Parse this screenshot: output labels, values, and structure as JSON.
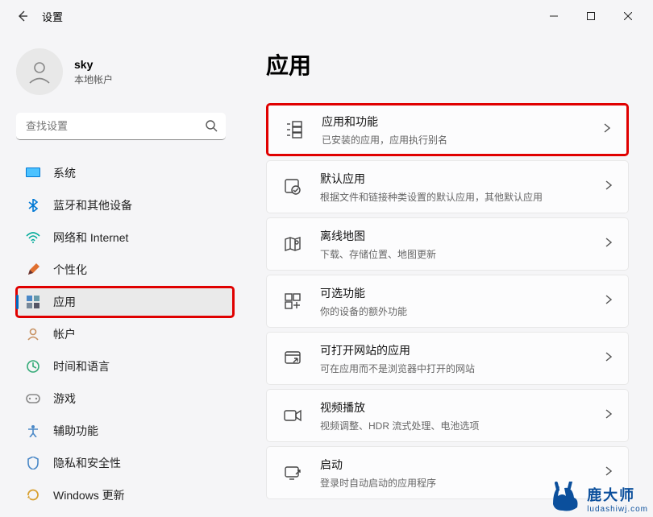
{
  "title": "设置",
  "user": {
    "name": "sky",
    "sub": "本地帐户"
  },
  "search": {
    "placeholder": "查找设置"
  },
  "nav": {
    "system": "系统",
    "bluetooth": "蓝牙和其他设备",
    "network": "网络和 Internet",
    "personalization": "个性化",
    "apps": "应用",
    "accounts": "帐户",
    "time": "时间和语言",
    "gaming": "游戏",
    "accessibility": "辅助功能",
    "privacy": "隐私和安全性",
    "update": "Windows 更新"
  },
  "page": {
    "heading": "应用"
  },
  "cards": {
    "appsFeatures": {
      "title": "应用和功能",
      "sub": "已安装的应用，应用执行别名"
    },
    "defaultApps": {
      "title": "默认应用",
      "sub": "根据文件和链接种类设置的默认应用，其他默认应用"
    },
    "offlineMaps": {
      "title": "离线地图",
      "sub": "下载、存储位置、地图更新"
    },
    "optionalFeatures": {
      "title": "可选功能",
      "sub": "你的设备的额外功能"
    },
    "webApps": {
      "title": "可打开网站的应用",
      "sub": "可在应用而不是浏览器中打开的网站"
    },
    "video": {
      "title": "视频播放",
      "sub": "视频调整、HDR 流式处理、电池选项"
    },
    "startup": {
      "title": "启动",
      "sub": "登录时自动启动的应用程序"
    }
  },
  "watermark": {
    "brand": "鹿大师",
    "url": "ludashiwj.com"
  }
}
